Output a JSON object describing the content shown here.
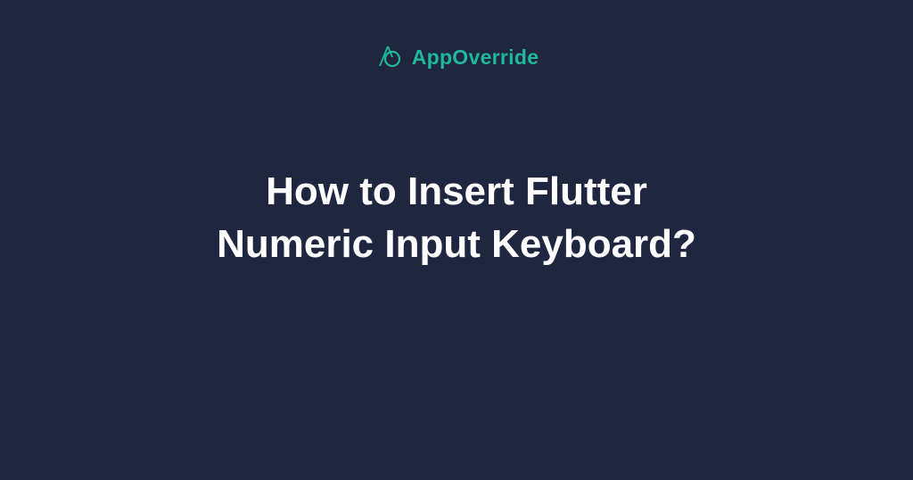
{
  "brand": {
    "name": "AppOverride",
    "accent_color": "#1fb89a"
  },
  "content": {
    "headline_line1": "How to Insert Flutter",
    "headline_line2": "Numeric Input Keyboard?"
  },
  "colors": {
    "background": "#1e2640",
    "text": "#ffffff",
    "accent": "#1fb89a"
  }
}
